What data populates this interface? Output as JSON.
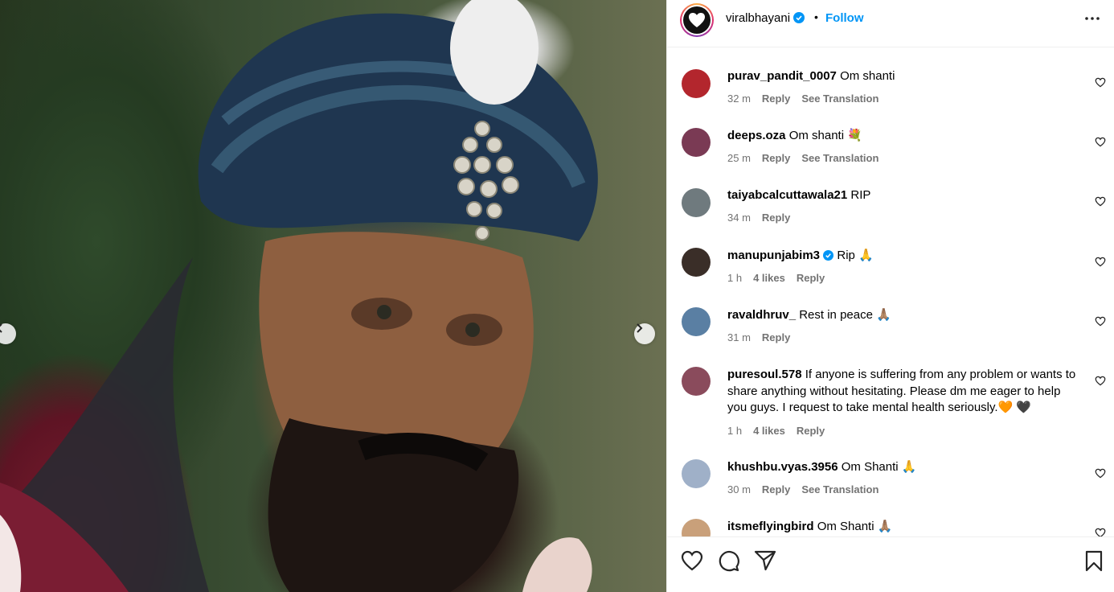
{
  "post": {
    "username": "viralbhayani",
    "separator": "•",
    "follow_label": "Follow",
    "verified": true
  },
  "media": {
    "description_icon": "photo",
    "prev_icon": "chevron-left-icon",
    "next_icon": "chevron-right-icon"
  },
  "comments": [
    {
      "username": "purav_pandit_0007",
      "text": "Om shanti",
      "time": "32 m",
      "likes": "",
      "reply": "Reply",
      "translate": "See Translation",
      "avatar_color": "#b3262d"
    },
    {
      "username": "deeps.oza",
      "text": "Om shanti 💐",
      "time": "25 m",
      "likes": "",
      "reply": "Reply",
      "translate": "See Translation",
      "avatar_color": "#7a3a54"
    },
    {
      "username": "taiyabcalcuttawala21",
      "text": "RIP",
      "time": "34 m",
      "likes": "",
      "reply": "Reply",
      "translate": "",
      "avatar_color": "#6f7a7e"
    },
    {
      "username": "manupunjabim3",
      "text": "Rip 🙏",
      "time": "1 h",
      "likes": "4 likes",
      "reply": "Reply",
      "translate": "",
      "verified": true,
      "avatar_color": "#3a2e28"
    },
    {
      "username": "ravaldhruv_",
      "text": "Rest in peace 🙏🏽",
      "time": "31 m",
      "likes": "",
      "reply": "Reply",
      "translate": "",
      "avatar_color": "#5a7fa3"
    },
    {
      "username": "puresoul.578",
      "text": "If anyone is suffering from any problem or wants to share anything without hesitating. Please dm me eager to help you guys. I request to take mental health seriously.🧡 🖤",
      "time": "1 h",
      "likes": "4 likes",
      "reply": "Reply",
      "translate": "",
      "avatar_color": "#8a4b5c"
    },
    {
      "username": "khushbu.vyas.3956",
      "text": "Om Shanti 🙏",
      "time": "30 m",
      "likes": "",
      "reply": "Reply",
      "translate": "See Translation",
      "avatar_color": "#9fb0c8"
    },
    {
      "username": "itsmeflyingbird",
      "text": "Om Shanti 🙏🏽",
      "time": "",
      "likes": "",
      "reply": "",
      "translate": "",
      "avatar_color": "#c9a07a"
    }
  ],
  "actions": {
    "like_icon": "heart-icon",
    "comment_icon": "comment-icon",
    "share_icon": "send-icon",
    "save_icon": "bookmark-icon"
  },
  "colors": {
    "accent": "#0095f6",
    "verified": "#0095f6",
    "meta_text": "#737373",
    "divider": "#efefef"
  }
}
